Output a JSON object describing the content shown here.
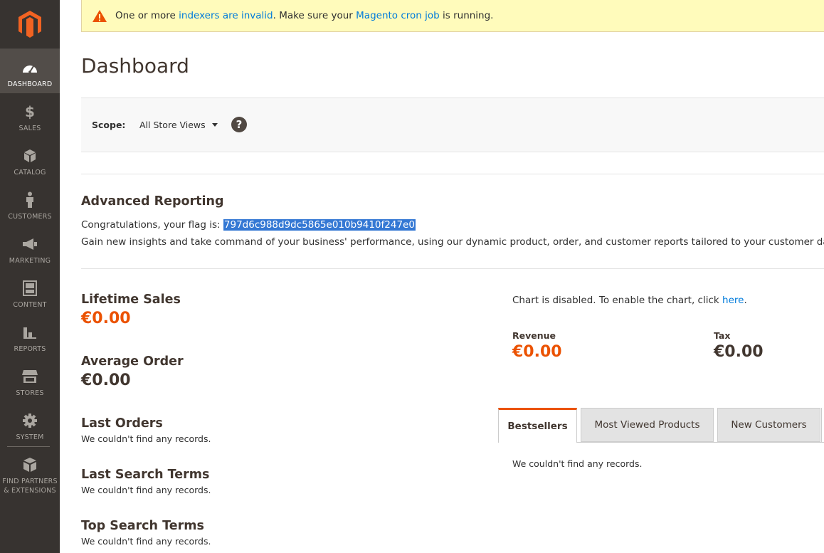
{
  "notice": {
    "text_before": "One or more ",
    "link1": "indexers are invalid",
    "text_middle": ". Make sure your ",
    "link2": "Magento cron job",
    "text_after": " is running."
  },
  "page_title": "Dashboard",
  "scope": {
    "label": "Scope:",
    "selected": "All Store Views",
    "help": "?"
  },
  "advanced_reporting": {
    "title": "Advanced Reporting",
    "flag_prefix": "Congratulations, your flag is: ",
    "flag": "797d6c988d9dc5865e010b9410f247e0",
    "description": "Gain new insights and take command of your business' performance, using our dynamic product, order, and customer reports tailored to your customer data."
  },
  "stats": {
    "lifetime_sales_label": "Lifetime Sales",
    "lifetime_sales_value": "€0.00",
    "average_order_label": "Average Order",
    "average_order_value": "€0.00"
  },
  "lists": {
    "last_orders_label": "Last Orders",
    "last_orders_empty": "We couldn't find any records.",
    "last_search_label": "Last Search Terms",
    "last_search_empty": "We couldn't find any records.",
    "top_search_label": "Top Search Terms",
    "top_search_empty": "We couldn't find any records."
  },
  "chart": {
    "message": "Chart is disabled. To enable the chart, click ",
    "link": "here",
    "suffix": "."
  },
  "totals": {
    "revenue_label": "Revenue",
    "revenue_value": "€0.00",
    "tax_label": "Tax",
    "tax_value": "€0.00"
  },
  "tabs": {
    "bestsellers": "Bestsellers",
    "most_viewed": "Most Viewed Products",
    "new_customers": "New Customers",
    "content_empty": "We couldn't find any records."
  },
  "sidebar": {
    "items": [
      {
        "label": "DASHBOARD",
        "icon": "dashboard-icon"
      },
      {
        "label": "SALES",
        "icon": "dollar-icon"
      },
      {
        "label": "CATALOG",
        "icon": "box-icon"
      },
      {
        "label": "CUSTOMERS",
        "icon": "person-icon"
      },
      {
        "label": "MARKETING",
        "icon": "megaphone-icon"
      },
      {
        "label": "CONTENT",
        "icon": "layout-icon"
      },
      {
        "label": "REPORTS",
        "icon": "bar-chart-icon"
      },
      {
        "label": "STORES",
        "icon": "store-icon"
      },
      {
        "label": "SYSTEM",
        "icon": "gear-icon"
      },
      {
        "label": "FIND PARTNERS & EXTENSIONS",
        "icon": "extensions-icon"
      }
    ]
  },
  "colors": {
    "accent": "#eb5202",
    "sidebar": "#373330",
    "link": "#007bdb",
    "notice": "#fffbbb"
  }
}
